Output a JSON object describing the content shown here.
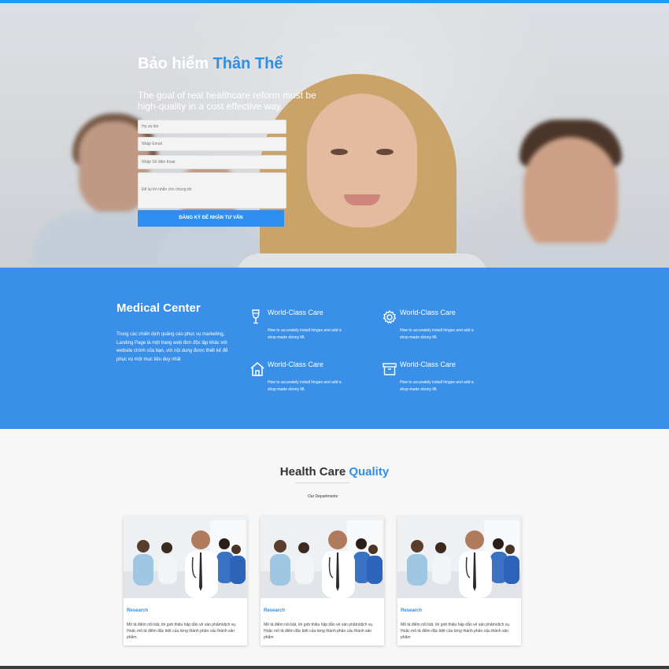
{
  "hero": {
    "title_main": "Bảo hiểm ",
    "title_accent": "Thân Thể",
    "subtitle": "The goal of real healthcare reform must be high-quality in a cost effective way.",
    "form": {
      "name_placeholder": "Họ và tên",
      "email_placeholder": "Nhập Email",
      "phone_placeholder": "Nhập Số điện thoại",
      "message_placeholder": "Để lại lời nhắn cho chúng tôi",
      "submit_label": "ĐĂNG KÝ ĐỂ NHẬN TƯ VẤN"
    }
  },
  "medical": {
    "title": "Medical Center",
    "description": "Trong các chiến dịch quảng cáo phục vụ marketing, Landing Page là một trang web đơn độc lập khác với website chính của bạn, với nội dung được thiết kế để phục vụ một mục tiêu duy nhất",
    "features": [
      {
        "icon": "wine-glass-icon",
        "title": "World-Class Care",
        "description": "How to accurately install hinges and add a shop-made ebony lift."
      },
      {
        "icon": "gear-icon",
        "title": "World-Class Care",
        "description": "How to accurately install hinges and add a shop-made ebony lift."
      },
      {
        "icon": "home-icon",
        "title": "World-Class Care",
        "description": "How to accurately install hinges and add a shop-made ebony lift."
      },
      {
        "icon": "archive-box-icon",
        "title": "World-Class Care",
        "description": "How to accurately install hinges and add a shop-made ebony lift."
      }
    ]
  },
  "healthcare": {
    "title_main": "Health Care ",
    "title_accent": "Quality",
    "subtitle": "Our Departments",
    "cards": [
      {
        "title": "Research",
        "description": "Mô tả điểm nổi bật, lời giới thiệu hấp dẫn về sản phẩm/dịch vụ. Hoặc mô tả điểm đặc biệt của từng thành phần cấu thành sản phẩm"
      },
      {
        "title": "Research",
        "description": "Mô tả điểm nổi bật, lời giới thiệu hấp dẫn về sản phẩm/dịch vụ. Hoặc mô tả điểm đặc biệt của từng thành phần cấu thành sản phẩm"
      },
      {
        "title": "Research",
        "description": "Mô tả điểm nổi bật, lời giới thiệu hấp dẫn về sản phẩm/dịch vụ. Hoặc mô tả điểm đặc biệt của từng thành phần cấu thành sản phẩm"
      }
    ]
  },
  "colors": {
    "accent": "#2f8fe8",
    "blue_section": "#3a90e8",
    "top_bar": "#1e9af0"
  }
}
